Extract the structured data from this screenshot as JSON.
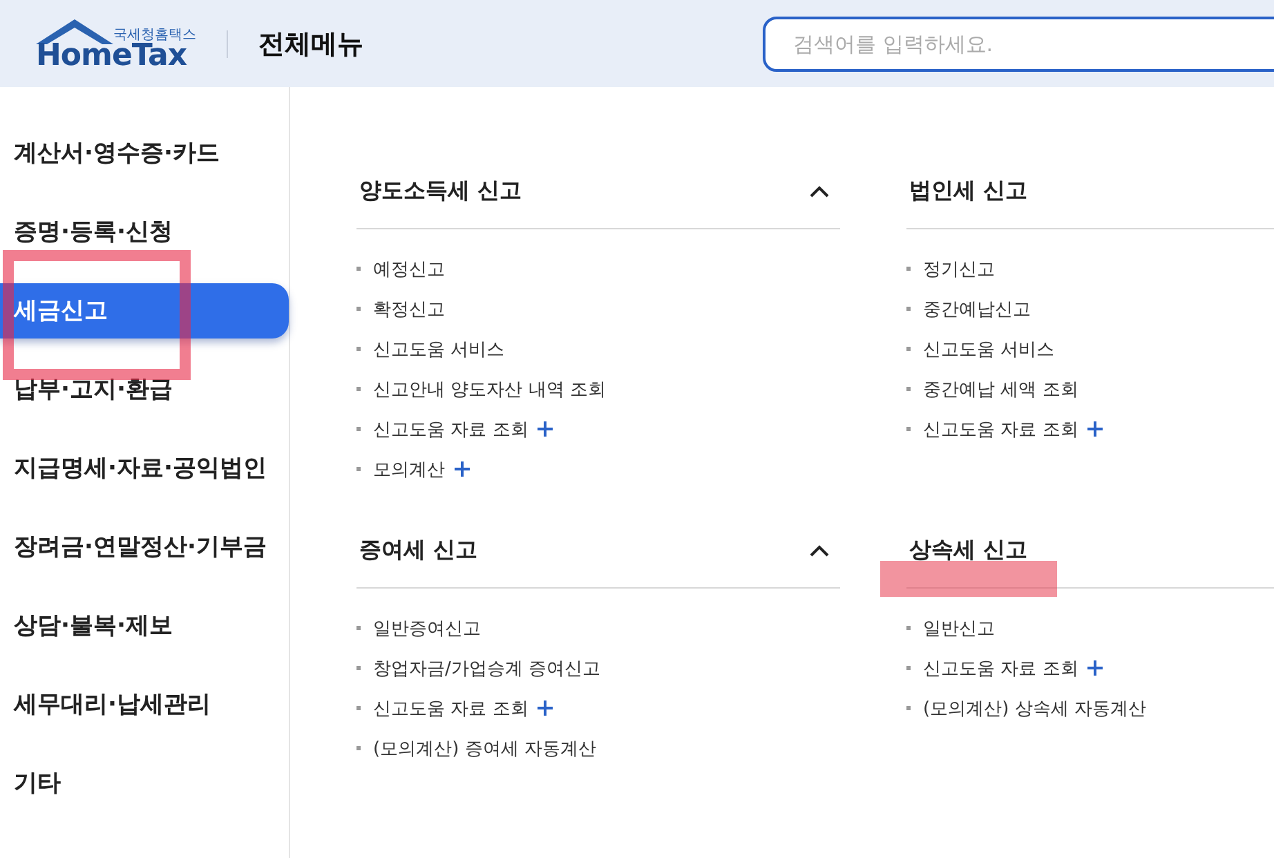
{
  "header": {
    "logo_caption": "국세청홈택스",
    "logo_text": "HomeTax",
    "title": "전체메뉴",
    "search": {
      "placeholder": "검색어를 입력하세요."
    }
  },
  "sidebar": {
    "items": [
      {
        "label": "계산서·영수증·카드",
        "selected": false
      },
      {
        "label": "증명·등록·신청",
        "selected": false
      },
      {
        "label": "세금신고",
        "selected": true
      },
      {
        "label": "납부·고지·환급",
        "selected": false
      },
      {
        "label": "지급명세·자료·공익법인",
        "selected": false
      },
      {
        "label": "장려금·연말정산·기부금",
        "selected": false
      },
      {
        "label": "상담·불복·제보",
        "selected": false
      },
      {
        "label": "세무대리·납세관리",
        "selected": false
      },
      {
        "label": "기타",
        "selected": false
      }
    ]
  },
  "sections": [
    {
      "title": "양도소득세 신고",
      "expanded": true,
      "links": [
        {
          "label": "예정신고",
          "more": false
        },
        {
          "label": "확정신고",
          "more": false
        },
        {
          "label": "신고도움 서비스",
          "more": false
        },
        {
          "label": "신고안내 양도자산 내역 조회",
          "more": false
        },
        {
          "label": "신고도움 자료 조회",
          "more": true
        },
        {
          "label": "모의계산",
          "more": true
        }
      ]
    },
    {
      "title": "법인세 신고",
      "links": [
        {
          "label": "정기신고",
          "more": false
        },
        {
          "label": "중간예납신고",
          "more": false
        },
        {
          "label": "신고도움 서비스",
          "more": false
        },
        {
          "label": "중간예납 세액 조회",
          "more": false
        },
        {
          "label": "신고도움 자료 조회",
          "more": true
        }
      ]
    },
    {
      "title": "증여세 신고",
      "expanded": true,
      "links": [
        {
          "label": "일반증여신고",
          "more": false
        },
        {
          "label": "창업자금/가업승계 증여신고",
          "more": false
        },
        {
          "label": "신고도움 자료 조회",
          "more": true
        },
        {
          "label": "(모의계산) 증여세 자동계산",
          "more": false
        }
      ]
    },
    {
      "title": "상속세 신고",
      "links": [
        {
          "label": "일반신고",
          "more": false
        },
        {
          "label": "신고도움 자료 조회",
          "more": true
        },
        {
          "label": "(모의계산) 상속세 자동계산",
          "more": false
        }
      ]
    }
  ]
}
